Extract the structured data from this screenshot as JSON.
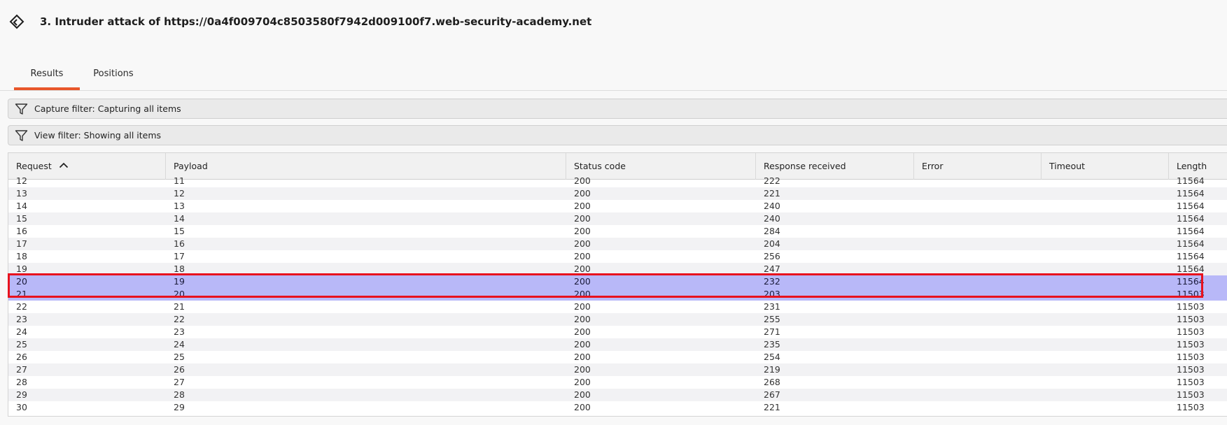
{
  "window": {
    "title": "3. Intruder attack of https://0a4f009704c8503580f7942d009100f7.web-security-academy.net",
    "icon": "burp-intruder-icon"
  },
  "tabs": [
    {
      "label": "Results",
      "active": true
    },
    {
      "label": "Positions",
      "active": false
    }
  ],
  "filters": {
    "capture": "Capture filter: Capturing all items",
    "view": "View filter: Showing all items"
  },
  "table": {
    "columns": [
      "Request",
      "Payload",
      "Status code",
      "Response received",
      "Error",
      "Timeout",
      "Length"
    ],
    "sort_column": "Request",
    "sort_direction": "ascending",
    "rows": [
      {
        "request": "12",
        "payload": "11",
        "status": "200",
        "response": "222",
        "error": "",
        "timeout": "",
        "length": "11564"
      },
      {
        "request": "13",
        "payload": "12",
        "status": "200",
        "response": "221",
        "error": "",
        "timeout": "",
        "length": "11564"
      },
      {
        "request": "14",
        "payload": "13",
        "status": "200",
        "response": "240",
        "error": "",
        "timeout": "",
        "length": "11564"
      },
      {
        "request": "15",
        "payload": "14",
        "status": "200",
        "response": "240",
        "error": "",
        "timeout": "",
        "length": "11564"
      },
      {
        "request": "16",
        "payload": "15",
        "status": "200",
        "response": "284",
        "error": "",
        "timeout": "",
        "length": "11564"
      },
      {
        "request": "17",
        "payload": "16",
        "status": "200",
        "response": "204",
        "error": "",
        "timeout": "",
        "length": "11564"
      },
      {
        "request": "18",
        "payload": "17",
        "status": "200",
        "response": "256",
        "error": "",
        "timeout": "",
        "length": "11564"
      },
      {
        "request": "19",
        "payload": "18",
        "status": "200",
        "response": "247",
        "error": "",
        "timeout": "",
        "length": "11564"
      },
      {
        "request": "20",
        "payload": "19",
        "status": "200",
        "response": "232",
        "error": "",
        "timeout": "",
        "length": "11564",
        "selected": true
      },
      {
        "request": "21",
        "payload": "20",
        "status": "200",
        "response": "203",
        "error": "",
        "timeout": "",
        "length": "11503",
        "selected": true
      },
      {
        "request": "22",
        "payload": "21",
        "status": "200",
        "response": "231",
        "error": "",
        "timeout": "",
        "length": "11503"
      },
      {
        "request": "23",
        "payload": "22",
        "status": "200",
        "response": "255",
        "error": "",
        "timeout": "",
        "length": "11503"
      },
      {
        "request": "24",
        "payload": "23",
        "status": "200",
        "response": "271",
        "error": "",
        "timeout": "",
        "length": "11503"
      },
      {
        "request": "25",
        "payload": "24",
        "status": "200",
        "response": "235",
        "error": "",
        "timeout": "",
        "length": "11503"
      },
      {
        "request": "26",
        "payload": "25",
        "status": "200",
        "response": "254",
        "error": "",
        "timeout": "",
        "length": "11503"
      },
      {
        "request": "27",
        "payload": "26",
        "status": "200",
        "response": "219",
        "error": "",
        "timeout": "",
        "length": "11503"
      },
      {
        "request": "28",
        "payload": "27",
        "status": "200",
        "response": "268",
        "error": "",
        "timeout": "",
        "length": "11503"
      },
      {
        "request": "29",
        "payload": "28",
        "status": "200",
        "response": "267",
        "error": "",
        "timeout": "",
        "length": "11503"
      },
      {
        "request": "30",
        "payload": "29",
        "status": "200",
        "response": "221",
        "error": "",
        "timeout": "",
        "length": "11503"
      }
    ]
  },
  "colors": {
    "accent": "#e8562a",
    "selected_row": "#b8b8f8",
    "highlight_border": "#e8121e"
  }
}
